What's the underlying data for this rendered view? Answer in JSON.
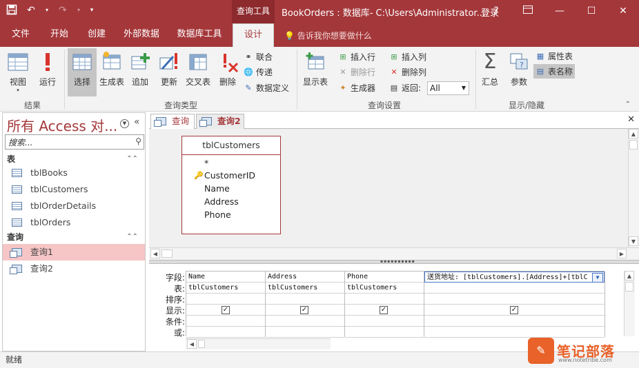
{
  "titlebar": {
    "context_tab": "查询工具",
    "window_title": "BookOrders : 数据库- C:\\Users\\Administrator...",
    "login": "登录",
    "help": "?",
    "save_icon": "save-icon",
    "undo_icon": "undo-icon",
    "redo_icon": "redo-icon"
  },
  "ribbon_tabs": [
    "文件",
    "开始",
    "创建",
    "外部数据",
    "数据库工具",
    "设计"
  ],
  "tell_me": "告诉我你想要做什么",
  "ribbon": {
    "results": {
      "label": "结果",
      "view": "视图",
      "run": "运行"
    },
    "query_type": {
      "label": "查询类型",
      "select": "选择",
      "make_table": "生成表",
      "append": "追加",
      "update": "更新",
      "crosstab": "交叉表",
      "delete": "删除",
      "union": "联合",
      "pass_through": "传递",
      "data_definition": "数据定义"
    },
    "query_setup": {
      "label": "查询设置",
      "show_table": "显示表",
      "insert_rows": "插入行",
      "delete_rows": "删除行",
      "builder": "生成器",
      "insert_columns": "插入列",
      "delete_columns": "删除列",
      "return_label": "返回:",
      "return_value": "All"
    },
    "show_hide": {
      "label": "显示/隐藏",
      "totals": "汇总",
      "parameters": "参数",
      "property_sheet": "属性表",
      "table_names": "表名称"
    }
  },
  "nav_pane": {
    "title": "所有 Access 对...",
    "search_placeholder": "搜索...",
    "sections": [
      {
        "label": "表",
        "items": [
          "tblBooks",
          "tblCustomers",
          "tblOrderDetails",
          "tblOrders"
        ]
      },
      {
        "label": "查询",
        "items": [
          "查询1",
          "查询2"
        ]
      }
    ]
  },
  "doc_tabs": [
    "查询1",
    "查询2"
  ],
  "field_list": {
    "title": "tblCustomers",
    "fields": [
      "*",
      "CustomerID",
      "Name",
      "Address",
      "Phone"
    ]
  },
  "design_grid": {
    "row_labels": [
      "字段:",
      "表:",
      "排序:",
      "显示:",
      "条件:",
      "或:"
    ],
    "columns": [
      {
        "field": "Name",
        "table": "tblCustomers",
        "show": true
      },
      {
        "field": "Address",
        "table": "tblCustomers",
        "show": true
      },
      {
        "field": "Phone",
        "table": "tblCustomers",
        "show": true
      },
      {
        "field": "送货地址: [tblCustomers].[Address]+[tblC",
        "table": "",
        "show": true
      }
    ]
  },
  "status_bar": {
    "text": "就绪"
  },
  "watermark": {
    "title": "笔记部落",
    "url": "www.notetribe.com"
  }
}
